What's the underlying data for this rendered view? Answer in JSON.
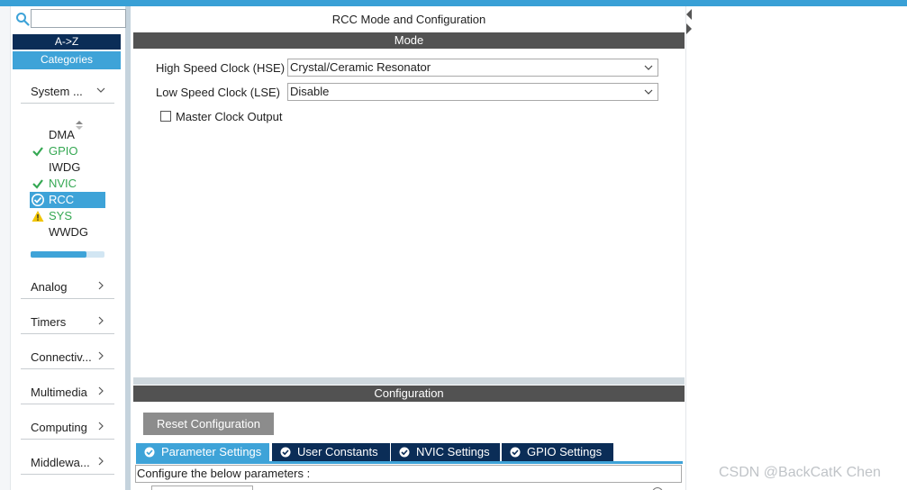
{
  "sidebar": {
    "search": {
      "value": "",
      "placeholder": ""
    },
    "sort_az_label": "A->Z",
    "categories_label": "Categories",
    "system_core": {
      "label": "System ...",
      "peripherals": [
        {
          "name": "DMA",
          "status": "none"
        },
        {
          "name": "GPIO",
          "status": "ok"
        },
        {
          "name": "IWDG",
          "status": "none"
        },
        {
          "name": "NVIC",
          "status": "ok"
        },
        {
          "name": "RCC",
          "status": "ok-selected"
        },
        {
          "name": "SYS",
          "status": "warning"
        },
        {
          "name": "WWDG",
          "status": "none"
        }
      ],
      "scroll_fraction": 0.75
    },
    "categories": [
      {
        "label": "Analog"
      },
      {
        "label": "Timers"
      },
      {
        "label": "Connectiv..."
      },
      {
        "label": "Multimedia"
      },
      {
        "label": "Computing"
      },
      {
        "label": "Middlewa..."
      }
    ]
  },
  "main": {
    "title": "RCC Mode and Configuration",
    "mode_header": "Mode",
    "hse": {
      "label": "High Speed Clock (HSE)",
      "value": "Crystal/Ceramic Resonator"
    },
    "lse": {
      "label": "Low Speed Clock (LSE)",
      "value": "Disable"
    },
    "mco": {
      "label": "Master Clock Output",
      "checked": false
    },
    "config_header": "Configuration",
    "reset_button": "Reset Configuration",
    "tabs": [
      {
        "label": "Parameter Settings",
        "active": true
      },
      {
        "label": "User Constants",
        "active": false
      },
      {
        "label": "NVIC Settings",
        "active": false
      },
      {
        "label": "GPIO Settings",
        "active": false
      }
    ],
    "param_hint": "Configure the below parameters :"
  },
  "watermark": "CSDN @BackCatK Chen",
  "colors": {
    "accent": "#3ea3d8",
    "navy": "#0b2d57",
    "band": "#525252",
    "ok_green": "#35a853",
    "warning": "#f2c500"
  }
}
